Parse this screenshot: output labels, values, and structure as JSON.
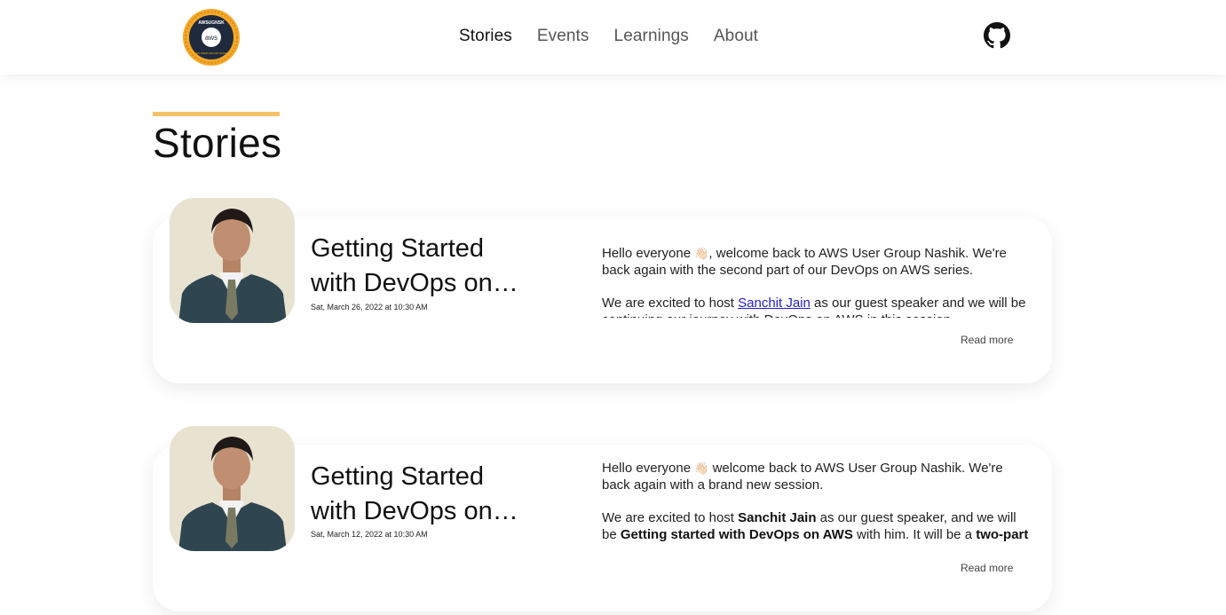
{
  "nav": {
    "logo_text_top": "AWSUGNSK",
    "logo_text_center": "aws",
    "logo_text_bottom": "AWS USER GROUP NASHIK",
    "links": [
      "Stories",
      "Events",
      "Learnings",
      "About"
    ],
    "active": "Stories",
    "icon": "github-icon"
  },
  "page": {
    "title": "Stories",
    "accent_color": "#f5c26a"
  },
  "stories": [
    {
      "title": "Getting Started with DevOps on AWS",
      "date": "Sat, March 26, 2022 at 10:30 AM",
      "para1_pre": "Hello everyone ",
      "emoji": "👋🏻",
      "para1_post": ", welcome back to AWS User Group Nashik. We're back again with the second part of our DevOps on AWS series.",
      "para2_pre": "We are excited to host ",
      "speaker": "Sanchit Jain",
      "para2_post": " as our guest speaker and we will be continuing our journey with DevOps on AWS in this session.",
      "read_more": "Read more"
    },
    {
      "title": "Getting Started with DevOps on AWS",
      "date": "Sat, March 12, 2022 at 10:30 AM",
      "para1_pre": "Hello everyone ",
      "emoji": "👋🏻",
      "para1_post": " welcome back to AWS User Group Nashik. We're back again with a brand new session.",
      "para2_pre": "We are excited to host ",
      "speaker": "Sanchit Jain",
      "para2_mid": " as our guest speaker, and we will be ",
      "topic": "Getting started with DevOps on AWS",
      "para2_post": " with him. It will be a ",
      "series": "two-part",
      "read_more": "Read more"
    }
  ]
}
